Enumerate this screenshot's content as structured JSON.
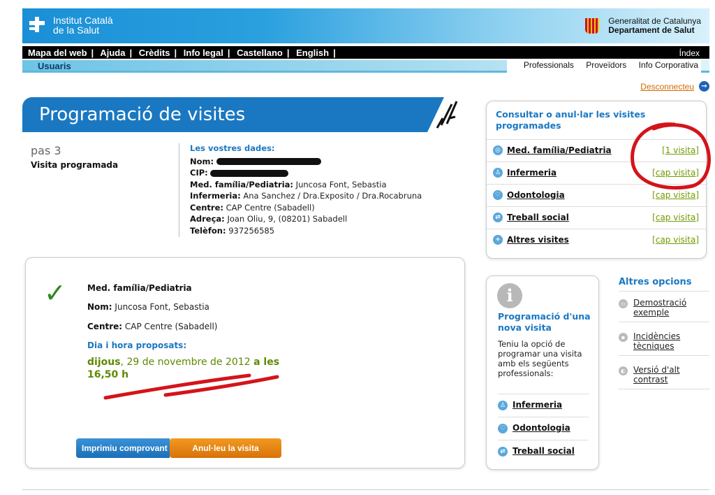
{
  "header": {
    "org_name_line1": "Institut Català",
    "org_name_line2": "de la Salut",
    "gov_line1": "Generalitat de Catalunya",
    "gov_line2": "Departament de Salut"
  },
  "topnav": {
    "links": [
      "Mapa del web",
      "Ajuda",
      "Crèdits",
      "Info legal",
      "Castellano",
      "English"
    ],
    "index": "Índex"
  },
  "subnav": {
    "section": "Usuaris",
    "right_links": [
      "Professionals",
      "Proveïdors",
      "Info Corporativa"
    ]
  },
  "logout": "Desconnecteu",
  "page": {
    "title": "Programació de visites",
    "step_num": "pas 3",
    "step_label": "Visita programada"
  },
  "dades": {
    "heading": "Les vostres dades:",
    "nom_label": "Nom:",
    "cip_label": "CIP:",
    "med_label": "Med. família/Pediatria:",
    "med_value": "Juncosa Font, Sebastia",
    "inf_label": "Infermeria:",
    "inf_value": "Ana Sanchez / Dra.Exposito / Dra.Rocabruna",
    "centre_label": "Centre:",
    "centre_value": "CAP Centre (Sabadell)",
    "adreca_label": "Adreça:",
    "adreca_value": "Joan Oliu, 9, (08201) Sabadell",
    "tel_label": "Telèfon:",
    "tel_value": "937256585"
  },
  "visit": {
    "specialty": "Med. família/Pediatria",
    "nom_label": "Nom:",
    "nom_value": "Juncosa Font, Sebastia",
    "centre_label": "Centre:",
    "centre_value": "CAP Centre (Sabadell)",
    "proposed_label": "Dia i hora proposats:",
    "day": "dijous",
    "date": ", 29 de novembre de 2012 ",
    "a_les": "a les",
    "time": "16,50 h",
    "print_button": "Imprimiu comprovant",
    "cancel_button": "Anul·leu la visita"
  },
  "consult": {
    "title": "Consultar o anul·lar les visites programades",
    "rows": [
      {
        "label": "Med. família/Pediatria",
        "count": "[1 visita]"
      },
      {
        "label": "Infermeria",
        "count": "[cap visita]"
      },
      {
        "label": "Odontologia",
        "count": "[cap visita]"
      },
      {
        "label": "Treball social",
        "count": "[cap visita]"
      },
      {
        "label": "Altres visites",
        "count": "[cap visita]"
      }
    ]
  },
  "new_visit": {
    "title": "Programació d'una nova visita",
    "description": "Teniu la opció de programar una visita amb els següents professionals:",
    "items": [
      "Infermeria",
      "Odontologia",
      "Treball social"
    ]
  },
  "altres": {
    "title": "Altres opcions",
    "options": [
      "Demostració exemple",
      "Incidències tècniques",
      "Versió d'alt contrast"
    ]
  },
  "colors": {
    "primary_blue": "#1a78c2",
    "green_link": "#6f9a00",
    "orange": "#d8720a",
    "annotation_red": "#d4141a"
  }
}
